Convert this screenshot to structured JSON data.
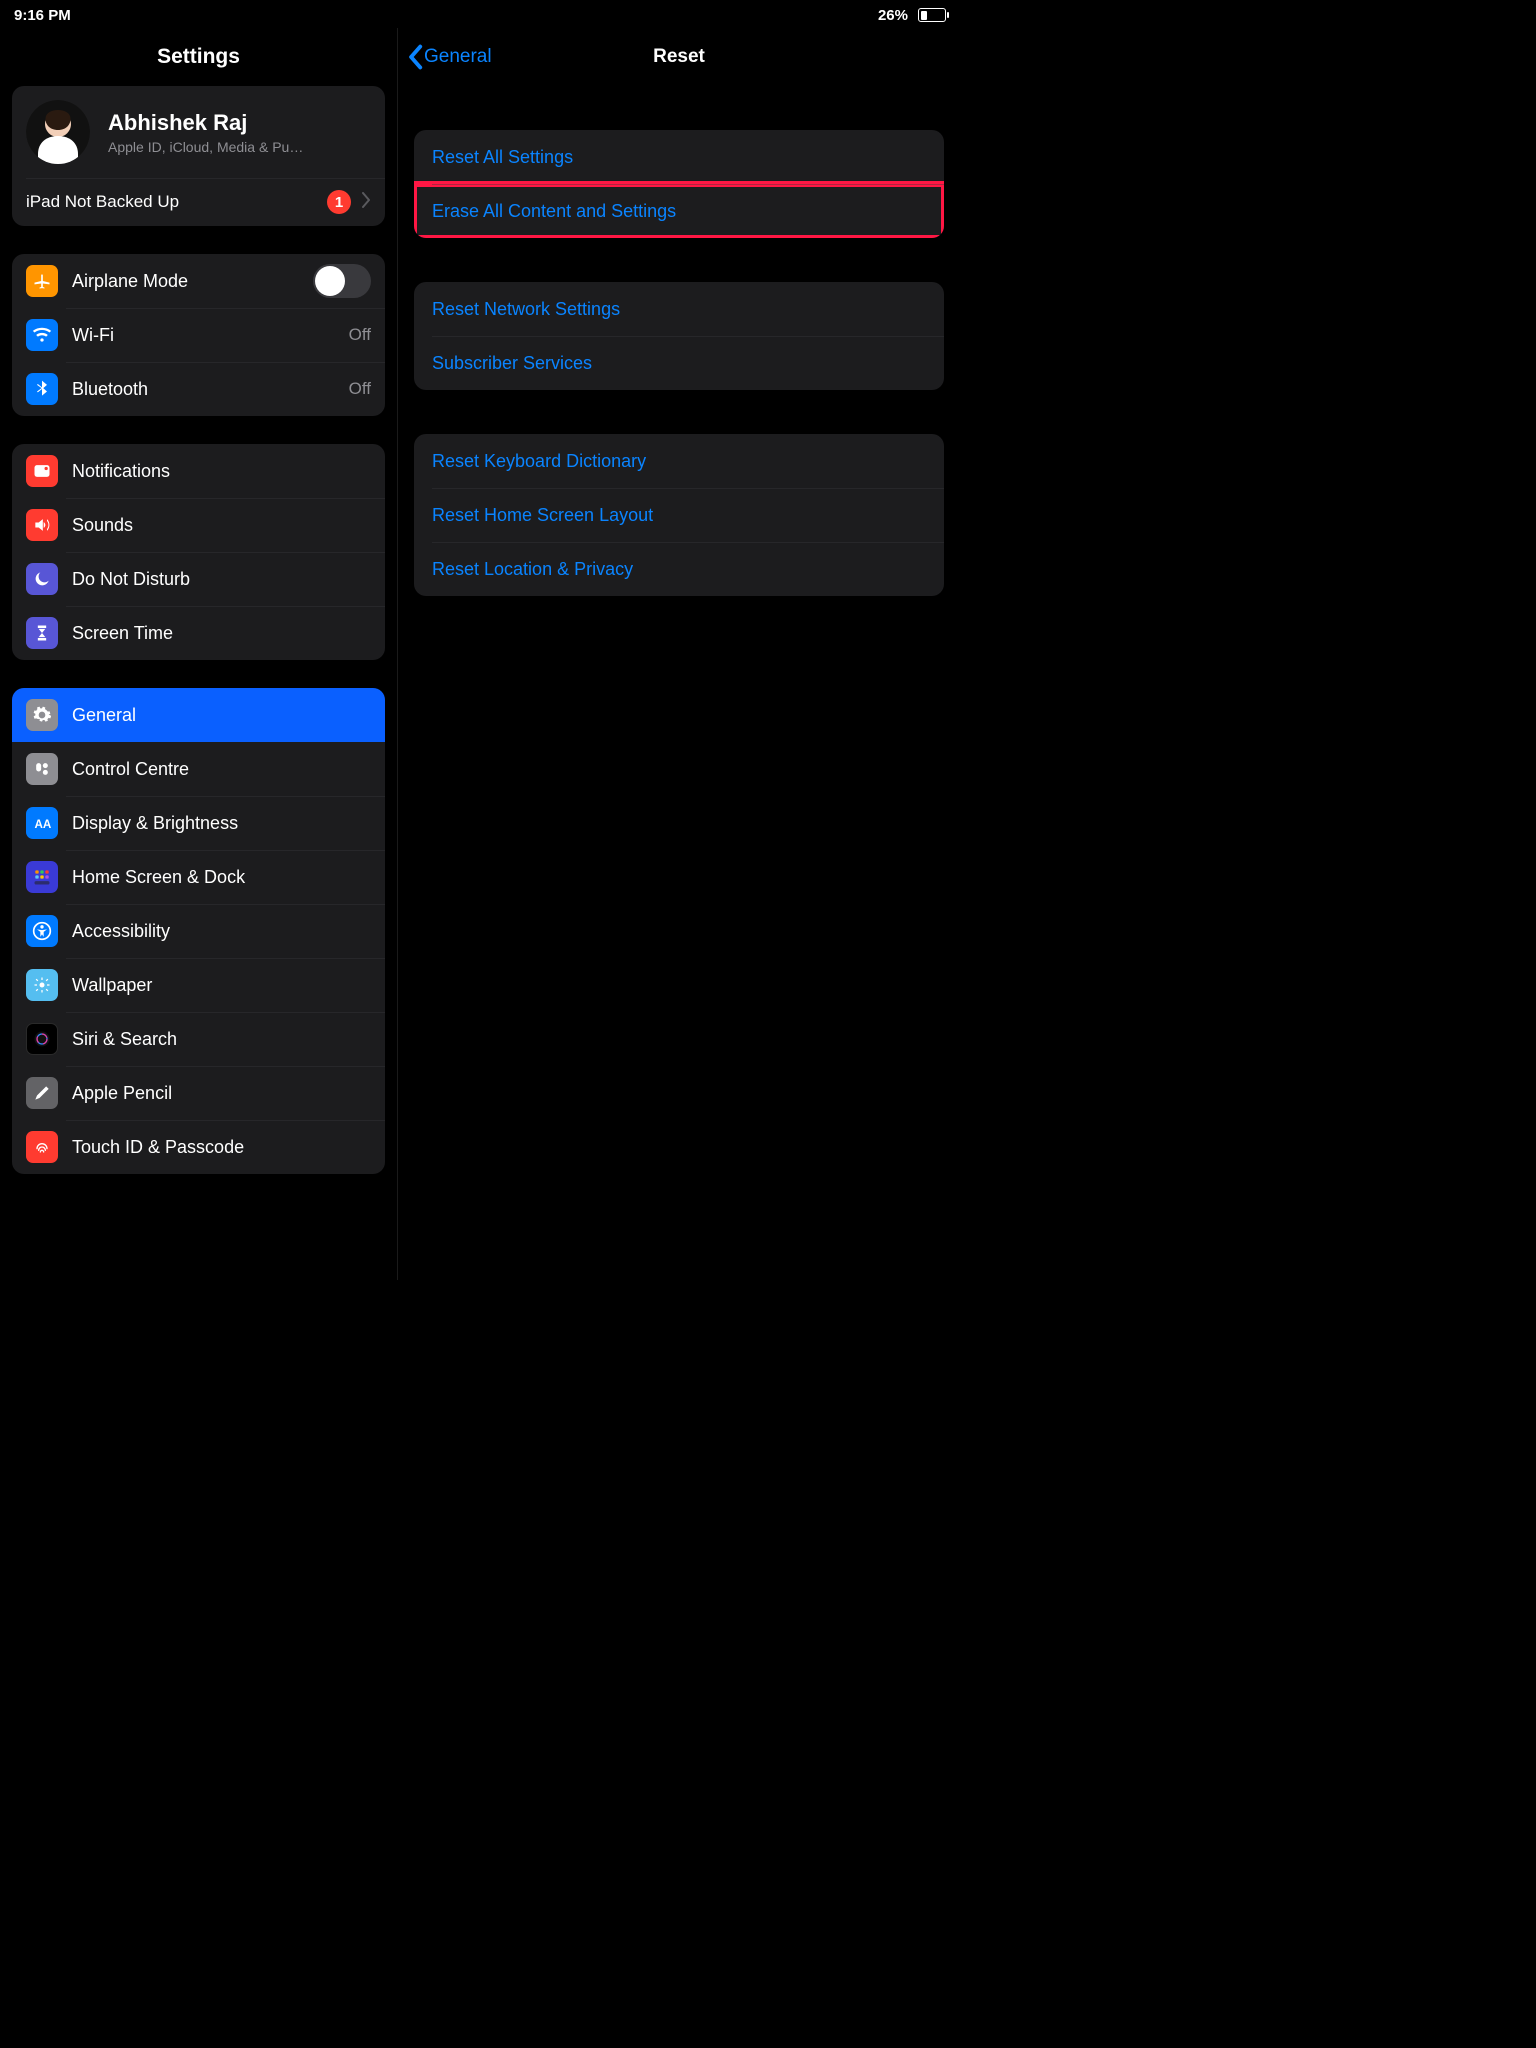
{
  "status": {
    "time": "9:16 PM",
    "battery_pct": "26%"
  },
  "sidebar": {
    "title": "Settings",
    "apple_id": {
      "name": "Abhishek Raj",
      "subtitle": "Apple ID, iCloud, Media & Pu…",
      "backup_row": "iPad Not Backed Up",
      "badge": "1"
    },
    "g1": {
      "airplane": "Airplane Mode",
      "wifi": "Wi-Fi",
      "wifi_val": "Off",
      "bt": "Bluetooth",
      "bt_val": "Off"
    },
    "g2": {
      "notifications": "Notifications",
      "sounds": "Sounds",
      "dnd": "Do Not Disturb",
      "screentime": "Screen Time"
    },
    "g3": {
      "general": "General",
      "control": "Control Centre",
      "display": "Display & Brightness",
      "home": "Home Screen & Dock",
      "access": "Accessibility",
      "wallpaper": "Wallpaper",
      "siri": "Siri & Search",
      "pencil": "Apple Pencil",
      "touchid": "Touch ID & Passcode"
    }
  },
  "detail": {
    "back": "General",
    "title": "Reset",
    "g1": {
      "reset_all": "Reset All Settings",
      "erase": "Erase All Content and Settings"
    },
    "g2": {
      "network": "Reset Network Settings",
      "subscriber": "Subscriber Services"
    },
    "g3": {
      "keyboard": "Reset Keyboard Dictionary",
      "homelayout": "Reset Home Screen Layout",
      "location": "Reset Location & Privacy"
    }
  }
}
